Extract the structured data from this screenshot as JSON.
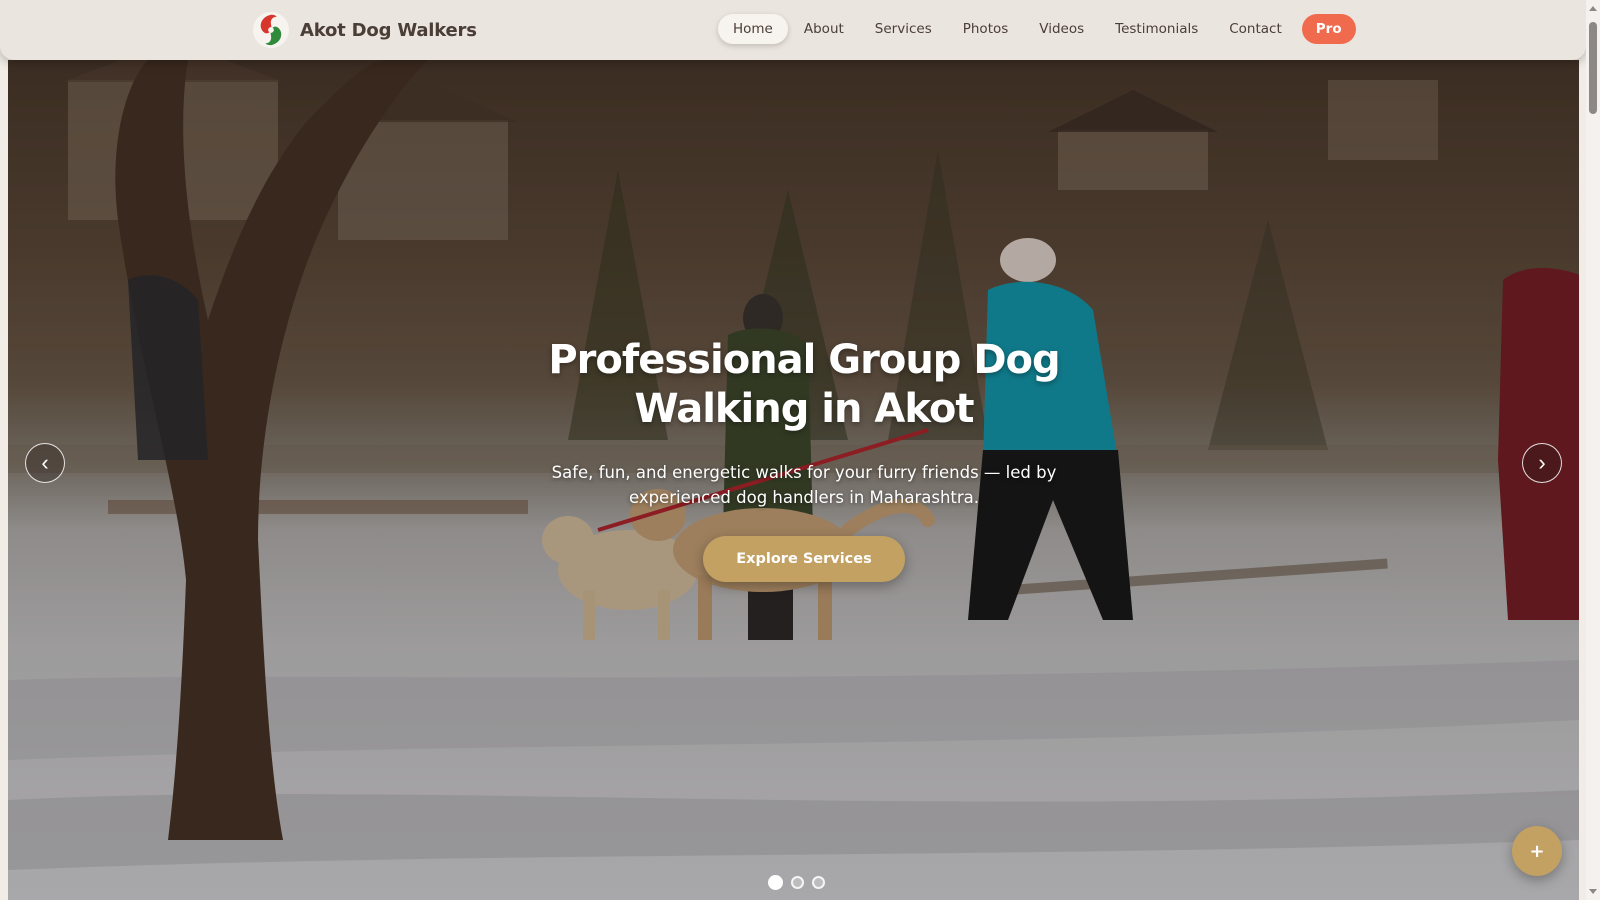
{
  "brand": {
    "name": "Akot Dog Walkers",
    "logo_icon": "red-green-swirl-logo"
  },
  "nav": {
    "items": [
      "Home",
      "About",
      "Services",
      "Photos",
      "Videos",
      "Testimonials",
      "Contact"
    ],
    "active": "Home",
    "pro_label": "Pro"
  },
  "hero": {
    "title": "Professional Group Dog Walking in Akot",
    "subtitle": "Safe, fun, and energetic walks for your furry friends — led by experienced dog handlers in Maharashtra.",
    "cta_label": "Explore Services",
    "prev_icon": "‹",
    "next_icon": "›",
    "slides_count": 3,
    "active_slide": 1
  },
  "fab": {
    "label": "+"
  },
  "colors": {
    "accent": "#c3a163",
    "pro": "#f06b4e",
    "text": "#4a3e37",
    "nav_bg": "#ebe5df"
  }
}
